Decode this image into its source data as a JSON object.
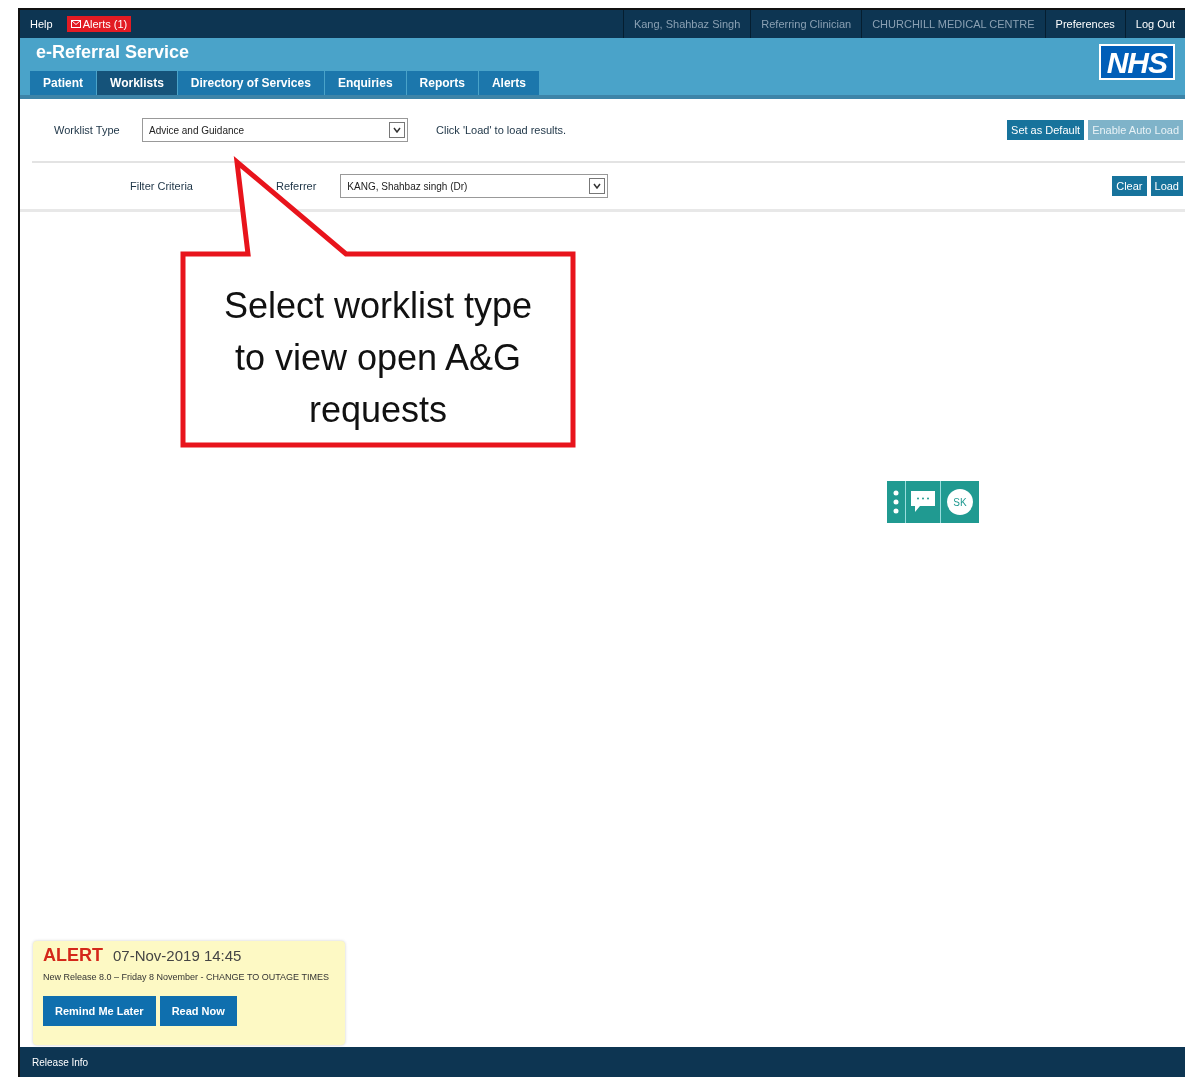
{
  "top_bar": {
    "help": "Help",
    "alerts": "Alerts (1)",
    "user_info": [
      "Kang, Shahbaz Singh",
      "Referring Clinician",
      "CHURCHILL MEDICAL CENTRE"
    ],
    "links": [
      "Preferences",
      "Log Out"
    ]
  },
  "header": {
    "title": "e-Referral Service",
    "logo": "NHS"
  },
  "tabs": [
    {
      "label": "Patient",
      "selected": false
    },
    {
      "label": "Worklists",
      "selected": true
    },
    {
      "label": "Directory of Services",
      "selected": false
    },
    {
      "label": "Enquiries",
      "selected": false
    },
    {
      "label": "Reports",
      "selected": false
    },
    {
      "label": "Alerts",
      "selected": false
    }
  ],
  "worklist": {
    "label": "Worklist Type",
    "value": "Advice and Guidance",
    "hint": "Click 'Load' to load results.",
    "buttons": [
      {
        "label": "Set as Default",
        "disabled": false
      },
      {
        "label": "Enable Auto Load",
        "disabled": true
      }
    ]
  },
  "filter": {
    "heading": "Filter Criteria",
    "referrer_label": "Referrer",
    "referrer_value": "KANG, Shahbaz singh (Dr)",
    "buttons": [
      {
        "label": "Clear",
        "disabled": false
      },
      {
        "label": "Load",
        "disabled": false
      }
    ]
  },
  "callout": {
    "text": "Select worklist type to view open A&G requests"
  },
  "chat_widget": {
    "avatar": "SK"
  },
  "alert": {
    "title": "ALERT",
    "datetime": "07-Nov-2019 14:45",
    "message": "New Release 8.0 – Friday 8 November - CHANGE TO OUTAGE TIMES",
    "buttons": [
      "Remind Me Later",
      "Read Now"
    ]
  },
  "footer": {
    "text": "Release Info"
  }
}
